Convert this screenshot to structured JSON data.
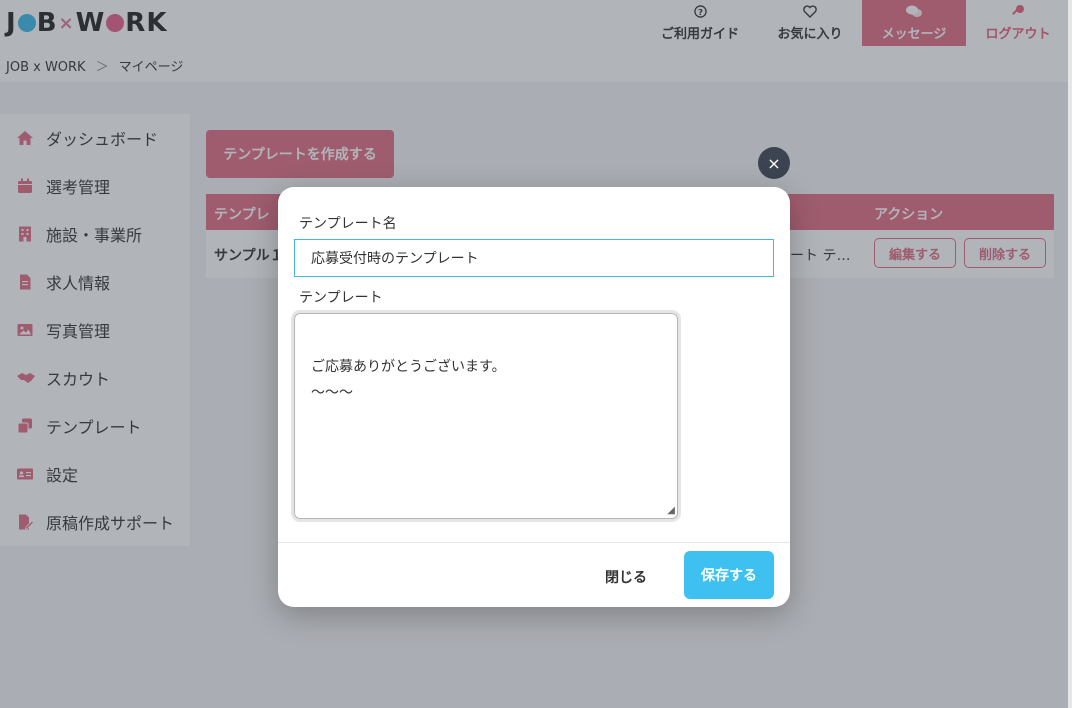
{
  "header": {
    "logo": {
      "j": "J",
      "b": "B",
      "x": "×",
      "w": "W",
      "rk": "RK"
    },
    "nav": {
      "guide": "ご利用ガイド",
      "favorites": "お気に入り",
      "messages": "メッセージ",
      "logout": "ログアウト"
    }
  },
  "breadcrumb": {
    "home": "JOB x WORK",
    "sep": "＞",
    "current": "マイページ"
  },
  "sidebar": {
    "items": [
      {
        "label": "ダッシュボード",
        "icon": "home-icon"
      },
      {
        "label": "選考管理",
        "icon": "calendar-icon"
      },
      {
        "label": "施設・事業所",
        "icon": "building-icon"
      },
      {
        "label": "求人情報",
        "icon": "file-icon"
      },
      {
        "label": "写真管理",
        "icon": "image-icon"
      },
      {
        "label": "スカウト",
        "icon": "handshake-icon"
      },
      {
        "label": "テンプレート",
        "icon": "copy-icon"
      },
      {
        "label": "設定",
        "icon": "id-card-icon"
      },
      {
        "label": "原稿作成サポート",
        "icon": "file-edit-icon"
      }
    ]
  },
  "main": {
    "create_button": "テンプレートを作成する",
    "table": {
      "headers": {
        "name": "テンプレ",
        "action": "アクション"
      },
      "rows": [
        {
          "name": "サンプル１",
          "preview": "ート テ…",
          "edit": "編集する",
          "delete": "削除する"
        }
      ]
    }
  },
  "modal": {
    "name_label": "テンプレート名",
    "name_value": "応募受付時のテンプレート",
    "template_label": "テンプレート",
    "template_value": "ご応募ありがとうございます。\n〜〜〜",
    "close_label": "閉じる",
    "save_label": "保存する",
    "close_x": "×"
  },
  "colors": {
    "accent": "#e16d84",
    "primary": "#3ec1f0",
    "overlay": "rgba(60,68,80,0.40)"
  }
}
